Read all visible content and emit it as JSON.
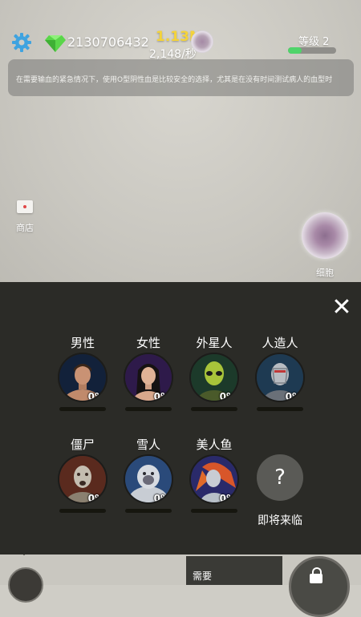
{
  "hud": {
    "gems": "2130706432",
    "cells_total": "1.13M",
    "cells_rate": "2,148/秒",
    "level_label": "等级 2",
    "level_progress": 0.28,
    "tip": "在需要输血的紧急情况下，使用O型阴性血是比较安全的选择，尤其是在没有时间测试病人的血型时"
  },
  "side": {
    "shop_label": "商店",
    "cell_label": "细胞"
  },
  "panel": {
    "close_icon": "close-icon",
    "species": [
      {
        "label": "男性",
        "percent": "0%",
        "progress": 0
      },
      {
        "label": "女性",
        "percent": "0%",
        "progress": 0
      },
      {
        "label": "外星人",
        "percent": "0%",
        "progress": 0
      },
      {
        "label": "人造人",
        "percent": "0%",
        "progress": 0
      },
      {
        "label": "僵尸",
        "percent": "0%",
        "progress": 0
      },
      {
        "label": "雪人",
        "percent": "0%",
        "progress": 0
      },
      {
        "label": "美人鱼",
        "percent": "0%",
        "progress": 0
      }
    ],
    "coming_soon": {
      "symbol": "?",
      "label": "即将来临"
    }
  },
  "bottom": {
    "need_label": "需要"
  },
  "colors": {
    "accent_gold": "#f4d33a",
    "level_green": "#4fd46a",
    "panel_bg": "#2b2b27"
  }
}
